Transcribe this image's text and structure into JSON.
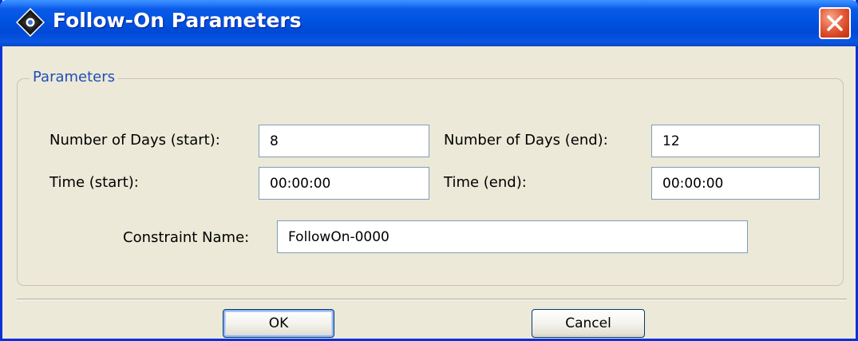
{
  "window": {
    "title": "Follow-On Parameters",
    "icon": "app-diamond-icon",
    "close_icon": "close-icon"
  },
  "group": {
    "title": "Parameters"
  },
  "fields": {
    "days_start": {
      "label": "Number of Days (start):",
      "value": "8"
    },
    "days_end": {
      "label": "Number of Days (end):",
      "value": "12"
    },
    "time_start": {
      "label": "Time (start):",
      "value": "00:00:00"
    },
    "time_end": {
      "label": "Time (end):",
      "value": "00:00:00"
    },
    "constraint_name": {
      "label": "Constraint Name:",
      "value": "FollowOn-0000"
    }
  },
  "buttons": {
    "ok": "OK",
    "cancel": "Cancel"
  },
  "colors": {
    "titlebar": "#0053e1",
    "window_bg": "#ece9d8",
    "group_title": "#1f4fb7",
    "close_button": "#d13f1d"
  }
}
